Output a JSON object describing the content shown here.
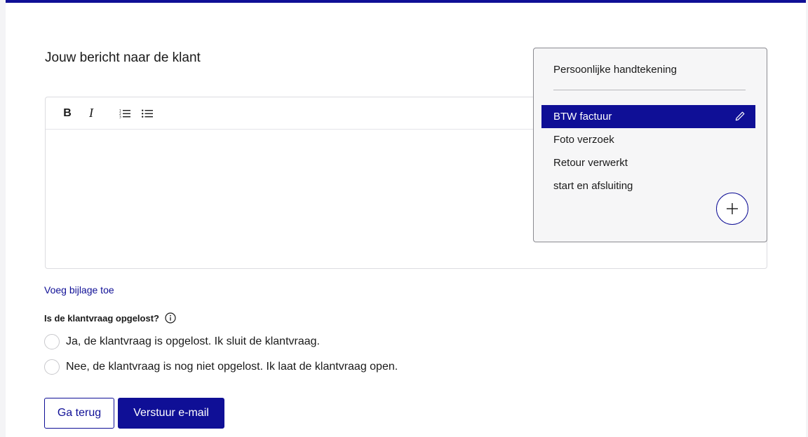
{
  "form": {
    "heading": "Jouw bericht naar de klant",
    "attach_link": "Voeg bijlage toe",
    "question": "Is de klantvraag opgelost?",
    "options": [
      "Ja, de klantvraag is opgelost. Ik sluit de klantvraag.",
      "Nee, de klantvraag is nog niet opgelost. Ik laat de klantvraag open."
    ],
    "back_label": "Ga terug",
    "send_label": "Verstuur e-mail"
  },
  "toolbar": {
    "bold": "B",
    "italic": "I",
    "ordered_list_icon": "ordered-list-icon",
    "bullet_list_icon": "bullet-list-icon"
  },
  "templates": {
    "signature": "Persoonlijke handtekening",
    "items": [
      "BTW factuur",
      "Foto verzoek",
      "Retour verwerkt",
      "start en afsluiting"
    ],
    "selected": "BTW factuur"
  },
  "colors": {
    "accent": "#0f0f96",
    "selected_text": "#ffffff",
    "border": "#dcdce0"
  }
}
